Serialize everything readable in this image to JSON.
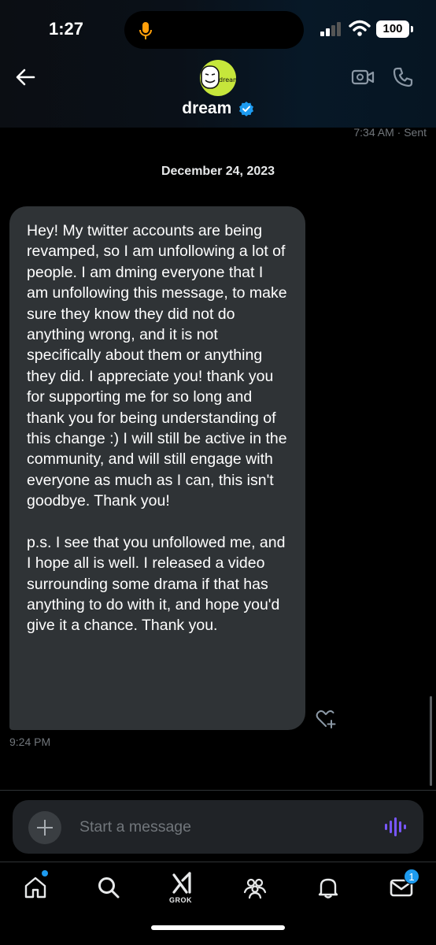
{
  "status_bar": {
    "time": "1:27",
    "battery": "100"
  },
  "header": {
    "name": "dream",
    "avatar_text": "dream"
  },
  "thread": {
    "last_sent_time": "7:34 AM",
    "last_sent_status": "· Sent",
    "date_separator": "December 24, 2023",
    "message": {
      "paragraph1": "Hey! My twitter accounts are being revamped, so I am unfollowing a lot of people. I am dming everyone that I am unfollowing this message, to make sure they know they did not do anything wrong, and it is not specifically about them or anything they did. I appreciate you! thank you for supporting me for so long and thank you for being understanding of this change :) I will still be active in the community, and will still engage with everyone as much as I can, this isn't goodbye. Thank you!",
      "paragraph2": "p.s. I see that you unfollowed me, and I hope all is well. I released a video surrounding some drama if that has anything to do with it, and hope you'd give it a chance. Thank you.",
      "time": "9:24 PM"
    }
  },
  "composer": {
    "placeholder": "Start a message"
  },
  "nav": {
    "items": [
      "home-icon",
      "search-icon",
      "grok-icon",
      "communities-icon",
      "notifications-icon",
      "messages-icon"
    ],
    "grok_label": "GROK",
    "messages_badge": "1"
  },
  "colors": {
    "accent": "#1d9bf0",
    "bubble": "#2f3336",
    "avatar": "#c6e63b",
    "mic": "#ff9f0a",
    "voice": "#7856ff"
  }
}
